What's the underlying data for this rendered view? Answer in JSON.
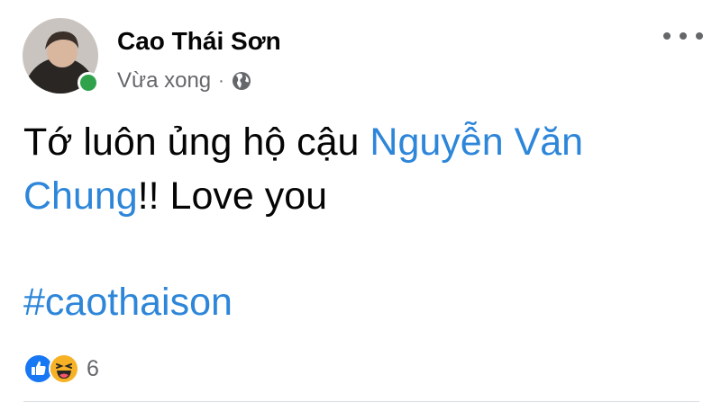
{
  "post": {
    "author": {
      "name": "Cao Thái Sơn",
      "status": "online"
    },
    "meta": {
      "time": "Vừa xong",
      "separator": "·",
      "privacy_icon": "globe-icon"
    },
    "content": {
      "text_before_link": "Tớ luôn ủng hộ cậu ",
      "mention": "Nguyễn Văn Chung",
      "text_after_link": "!! Love you",
      "hashtag": "#caothaison"
    },
    "reactions": {
      "icons": [
        "like-icon",
        "haha-icon"
      ],
      "count": "6"
    }
  },
  "colors": {
    "link": "#2d86d9",
    "online": "#31a24c",
    "meta_text": "#65676b",
    "like": "#1877f2",
    "haha": "#f7b125"
  }
}
